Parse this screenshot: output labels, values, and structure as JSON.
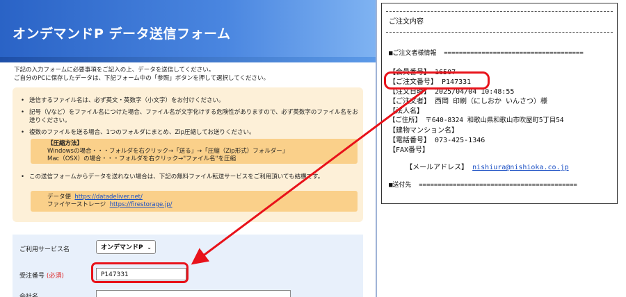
{
  "form": {
    "title": "オンデマンドP データ送信フォーム",
    "intro_line1": "下記の入力フォームに必要事項をご記入の上、データを送信してください。",
    "intro_line2": "ご自分のPCに保存したデータは、下記フォーム中の「参照」ボタンを押して選択してください。",
    "notices": [
      "送信するファイル名は、必ず英文・英数字（小文字）をお付けください。",
      "記号（\\/など）をファイル名につけた場合、ファイル名が文字化けする危険性がありますので、必ず英数字のファイル名をお送りください。",
      "複数のファイルを送る場合、1つのフォルダにまとめ、Zip圧縮してお送りください。",
      "この送信フォームからデータを送れない場合は、下記の無料ファイル転送サービスをご利用頂いても結構です。"
    ],
    "compress": {
      "heading": "【圧縮方法】",
      "windows": "Windowsの場合・・・フォルダを右クリック→「送る」→「圧縮（Zip形式）フォルダー」",
      "mac": "Mac（OSX）の場合・・・フォルダを右クリック→\"ファイル名\"を圧縮"
    },
    "services": {
      "datadeliver_label": "データ便",
      "datadeliver_url": "https://datadeliver.net/",
      "firestorage_label": "ファイヤーストレージ",
      "firestorage_url": "https://firestorage.jp/"
    },
    "fields": {
      "service_label": "ご利用サービス名",
      "service_value": "オンデマンドP",
      "order_label": "受注番号",
      "order_required": "(必須)",
      "order_value": "P147331",
      "company_label": "会社名"
    }
  },
  "email": {
    "heading": "ご注文内容",
    "customer_section": "■ご注文者様情報  =====================================",
    "member_line": "【会員番号】 16507",
    "order_no_line": "【ご注文番号】 P147331",
    "order_date_line": "【注文日時】 2025/04/04 10:48:55",
    "orderer_line": "【ご注文者】 西岡 印刷（にしおか いんさつ）様",
    "corp_line": "【法人名】",
    "address_line": "【ご住所】 〒640-8324 和歌山県和歌山市吹屋町5丁目54",
    "building_line": "【建物マンション名】",
    "phone_line": "【電話番号】 073-425-1346",
    "fax_line": "【FAX番号】",
    "mail_label": "【メールアドレス】",
    "mail_value": "nishiura@nishioka.co.jp",
    "ship_section": "■送付先  =========================================="
  },
  "colors": {
    "accent_red": "#e8121a",
    "header_blue": "#2a63c6",
    "notice_bg": "#fdf0d8",
    "link_blue": "#1a4fc4"
  }
}
